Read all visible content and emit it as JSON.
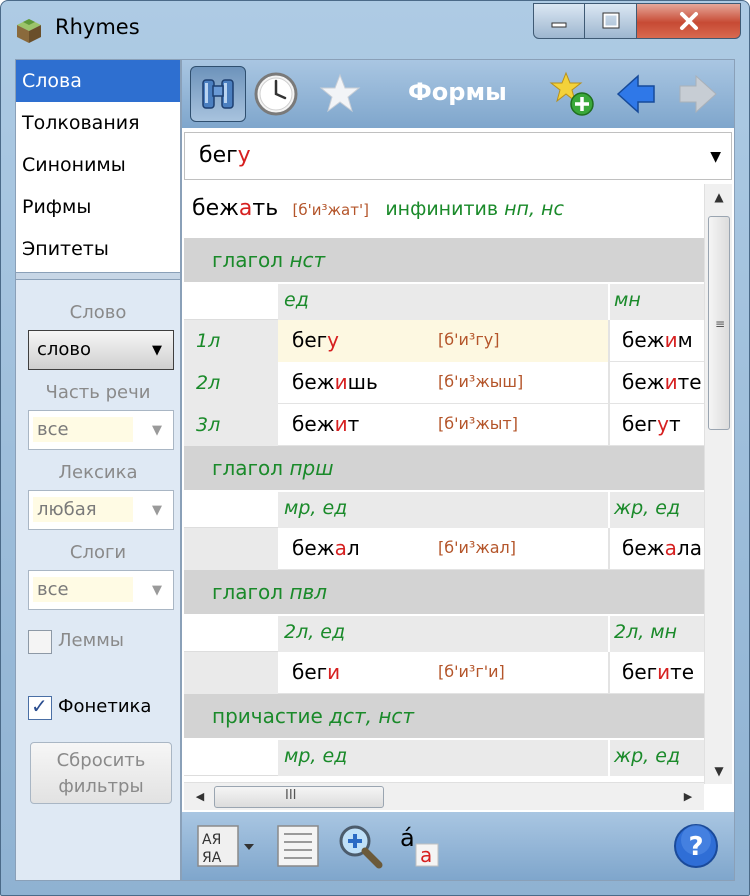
{
  "window": {
    "title": "Rhymes",
    "controls": {
      "minimize": "minimize",
      "maximize": "maximize",
      "close": "close"
    }
  },
  "sidebar": {
    "items": [
      {
        "label": "Слова",
        "selected": true
      },
      {
        "label": "Толкования",
        "selected": false
      },
      {
        "label": "Синонимы",
        "selected": false
      },
      {
        "label": "Рифмы",
        "selected": false
      },
      {
        "label": "Эпитеты",
        "selected": false
      }
    ],
    "filters": {
      "word_label": "Слово",
      "word_value": "слово",
      "pos_label": "Часть речи",
      "pos_value": "все",
      "lexicon_label": "Лексика",
      "lexicon_value": "любая",
      "syllables_label": "Слоги",
      "syllables_value": "все",
      "lemmas_label": "Леммы",
      "lemmas_checked": false,
      "phonetics_label": "Фонетика",
      "phonetics_checked": true,
      "reset_line1": "Сбросить",
      "reset_line2": "фильтры"
    }
  },
  "toolbar": {
    "title": "Формы",
    "icons": [
      "binoculars-icon",
      "clock-icon",
      "star-icon",
      "star-add-icon",
      "arrow-left-icon",
      "arrow-right-icon"
    ]
  },
  "search": {
    "value_stem": "бег",
    "value_stress": "у"
  },
  "lemma": {
    "word_pre": "беж",
    "word_stress": "а",
    "word_post": "ть",
    "transcription": "[б'и³жат']",
    "pos": "инфинитив",
    "pos_tags": "нп, нс"
  },
  "sections": [
    {
      "title": "глагол",
      "tag": "нст",
      "col1": "ед",
      "col2": "мн",
      "rows": [
        {
          "label": "1л",
          "w_pre": "бег",
          "w_str": "у",
          "w_post": "",
          "tr": "[б'и³гу]",
          "w2_pre": "беж",
          "w2_str": "и",
          "w2_post": "м",
          "highlight": true
        },
        {
          "label": "2л",
          "w_pre": "беж",
          "w_str": "и",
          "w_post": "шь",
          "tr": "[б'и³жыш]",
          "w2_pre": "беж",
          "w2_str": "и",
          "w2_post": "те",
          "highlight": false
        },
        {
          "label": "3л",
          "w_pre": "беж",
          "w_str": "и",
          "w_post": "т",
          "tr": "[б'и³жыт]",
          "w2_pre": "бег",
          "w2_str": "у",
          "w2_post": "т",
          "highlight": false
        }
      ]
    },
    {
      "title": "глагол",
      "tag": "прш",
      "col1": "мр, ед",
      "col2": "жр, ед",
      "rows": [
        {
          "label": "",
          "w_pre": "беж",
          "w_str": "а",
          "w_post": "л",
          "tr": "[б'и³жал]",
          "w2_pre": "беж",
          "w2_str": "а",
          "w2_post": "ла",
          "highlight": false
        }
      ]
    },
    {
      "title": "глагол",
      "tag": "пвл",
      "col1": "2л, ед",
      "col2": "2л, мн",
      "rows": [
        {
          "label": "",
          "w_pre": "бег",
          "w_str": "и",
          "w_post": "",
          "tr": "[б'и³г'и]",
          "w2_pre": "бег",
          "w2_str": "и",
          "w2_post": "те",
          "highlight": false
        }
      ]
    },
    {
      "title": "причастие",
      "tag": "дст, нст",
      "col1": "мр, ед",
      "col2": "жр, ед",
      "rows": []
    }
  ],
  "scroll": {
    "h_grip": "III",
    "v_grip": "≡"
  },
  "bottombar": {
    "icons": [
      "sort-icon",
      "list-icon",
      "zoom-icon",
      "accent-icon",
      "help-icon"
    ],
    "accent_a1": "á",
    "accent_a2": "a",
    "help": "?"
  },
  "colors": {
    "accent": "#2e6fd0",
    "stress": "#d62020",
    "grammar": "#1a8a2a",
    "transcription": "#b4552a"
  }
}
